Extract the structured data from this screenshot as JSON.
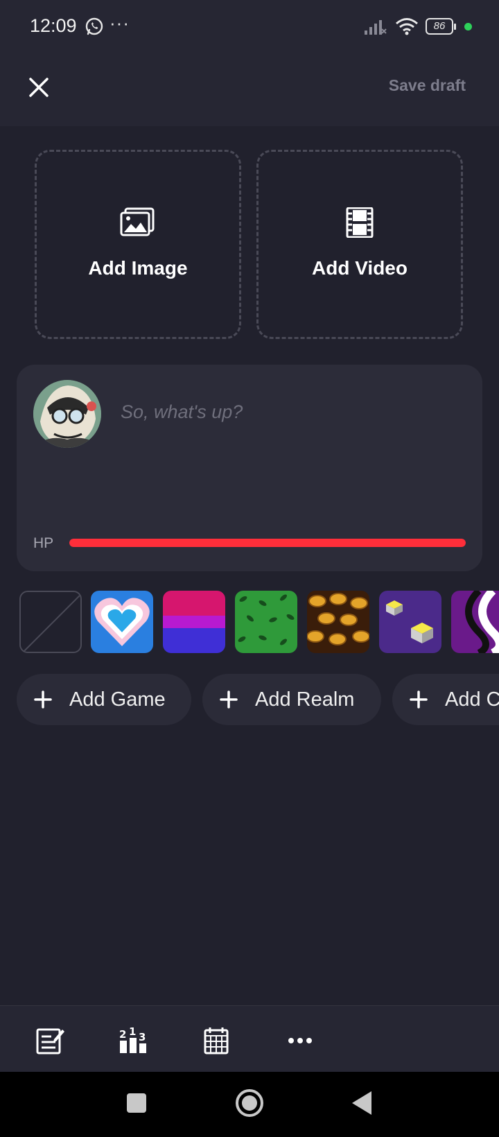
{
  "status_bar": {
    "time": "12:09",
    "more": "···",
    "battery": "86",
    "icons": [
      "whatsapp-icon",
      "signal-icon",
      "wifi-icon",
      "battery-icon"
    ],
    "charge_color": "#2ed15a"
  },
  "header": {
    "close_icon": "close-icon",
    "save_draft_label": "Save draft"
  },
  "media": {
    "add_image_label": "Add Image",
    "add_video_label": "Add Video",
    "icons": [
      "image-icon",
      "film-icon"
    ]
  },
  "compose": {
    "placeholder": "So, what's up?",
    "value": "",
    "hp_label": "HP",
    "hp_level_percent": 100,
    "hp_color": "#ff2e3a"
  },
  "themes": {
    "swatches": [
      "none",
      "heart",
      "bi-flag",
      "leaves",
      "coins",
      "cubes",
      "stripes"
    ]
  },
  "chips": [
    {
      "label": "Add Game",
      "icon": "plus-icon"
    },
    {
      "label": "Add Realm",
      "icon": "plus-icon"
    },
    {
      "label": "Add C",
      "icon": "plus-icon"
    }
  ],
  "toolbar": {
    "icons": [
      "compose-icon",
      "poll-icon",
      "calendar-icon",
      "more-icon"
    ]
  },
  "nav": {
    "icons": [
      "recents-icon",
      "home-icon",
      "back-icon"
    ]
  },
  "colors": {
    "background": "#21212d",
    "card": "#2c2c39",
    "muted_text": "#7d7d8c"
  }
}
